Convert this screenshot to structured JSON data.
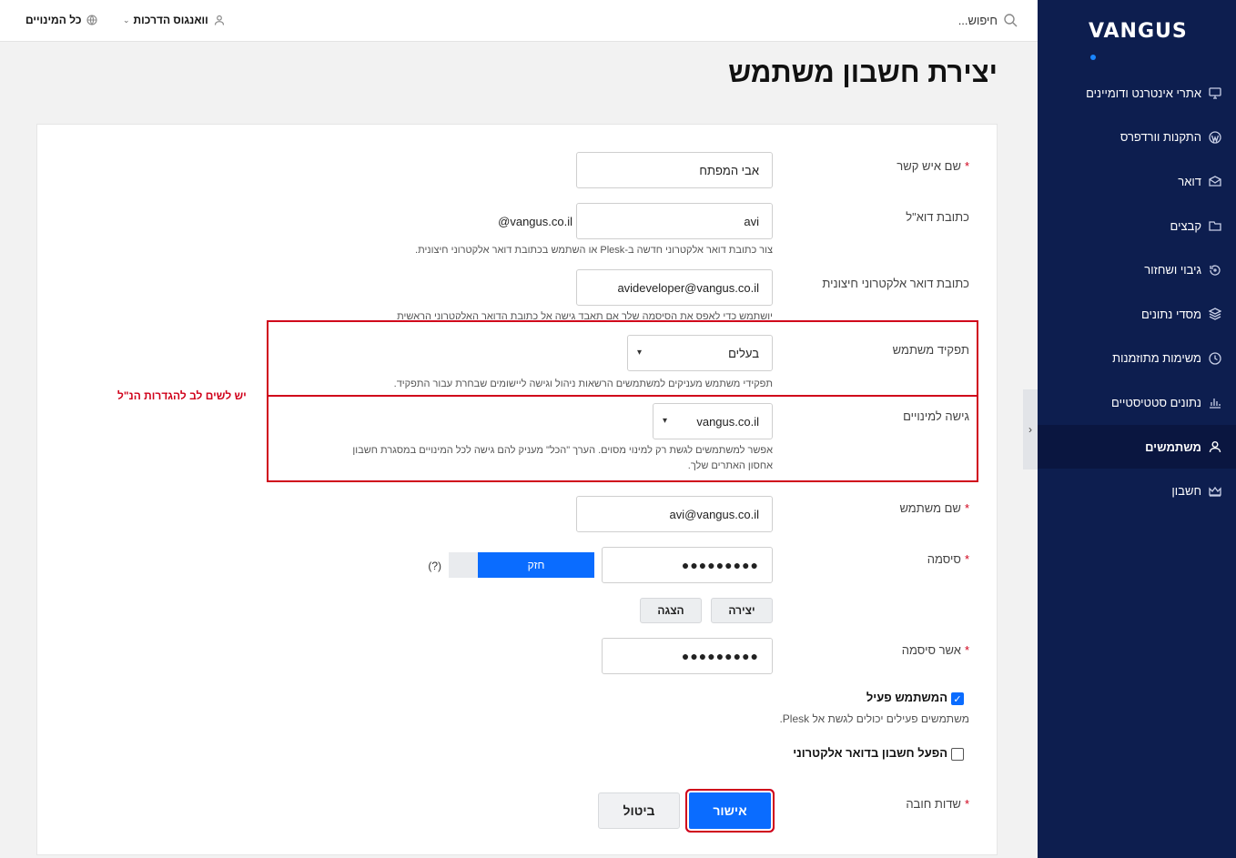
{
  "brand": {
    "logo_text": "VANGUS",
    "accent": "#1a86ff",
    "sidebar_bg": "#0d1e4f"
  },
  "topbar": {
    "search_placeholder": "חיפוש...",
    "user_name": "וואנגוס הדרכות",
    "subscriptions_label": "כל המינויים"
  },
  "sidebar": {
    "items": [
      {
        "label": "אתרי אינטרנט ודומיינים",
        "icon": "monitor-icon"
      },
      {
        "label": "התקנות וורדפרס",
        "icon": "wordpress-icon"
      },
      {
        "label": "דואר",
        "icon": "mail-icon"
      },
      {
        "label": "קבצים",
        "icon": "folder-icon"
      },
      {
        "label": "גיבוי ושחזור",
        "icon": "backup-icon"
      },
      {
        "label": "מסדי נתונים",
        "icon": "database-icon"
      },
      {
        "label": "משימות מתוזמנות",
        "icon": "clock-icon"
      },
      {
        "label": "נתונים סטטיסטיים",
        "icon": "chart-icon"
      },
      {
        "label": "משתמשים",
        "icon": "user-icon",
        "active": true
      },
      {
        "label": "חשבון",
        "icon": "crown-icon"
      }
    ]
  },
  "page": {
    "title": "יצירת חשבון משתמש"
  },
  "form": {
    "contact_name": {
      "label": "שם איש קשר",
      "value": "אבי המפתח"
    },
    "email": {
      "label": "כתובת דוא\"ל",
      "value": "avi",
      "domain": "@vangus.co.il",
      "hint": "צור כתובת דואר אלקטרוני חדשה ב-Plesk או השתמש בכתובת דואר אלקטרוני חיצונית."
    },
    "external_email": {
      "label": "כתובת דואר אלקטרוני חיצונית",
      "value": "avideveloper@vangus.co.il",
      "hint": "יושתמש כדי לאפס את הסיסמה שלך אם תאבד גישה אל כתובת הדואר האלקטרוני הראשית"
    },
    "role": {
      "label": "תפקיד משתמש",
      "value": "בעלים",
      "hint": "תפקידי משתמש מעניקים למשתמשים הרשאות ניהול וגישה ליישומים שבחרת עבור התפקיד."
    },
    "subscription_access": {
      "label": "גישה למינויים",
      "value": "vangus.co.il",
      "hint_line1": "אפשר למשתמשים לגשת רק למינוי מסוים. הערך \"הכל\" מעניק להם גישה לכל המינויים במסגרת חשבון",
      "hint_line2": "אחסון האתרים שלך."
    },
    "annotation": "יש לשים לב להגדרות הנ\"ל",
    "username": {
      "label": "שם משתמש",
      "value": "avi@vangus.co.il"
    },
    "password": {
      "label": "סיסמה",
      "value": "●●●●●●●●●",
      "strength_label": "חזק",
      "strength_fraction": 0.8,
      "help": "(?)",
      "generate_label": "יצירה",
      "show_label": "הצגה"
    },
    "confirm_password": {
      "label": "אשר סיסמה",
      "value": "●●●●●●●●●"
    },
    "active_user": {
      "label": "המשתמש פעיל",
      "checked": true,
      "hint": "משתמשים פעילים יכולים לגשת אל Plesk."
    },
    "mail_account": {
      "label": "הפעל חשבון בדואר אלקטרוני",
      "checked": false
    },
    "required_note": "שדות חובה",
    "required_marker": "*",
    "ok_label": "אישור",
    "cancel_label": "ביטול"
  }
}
